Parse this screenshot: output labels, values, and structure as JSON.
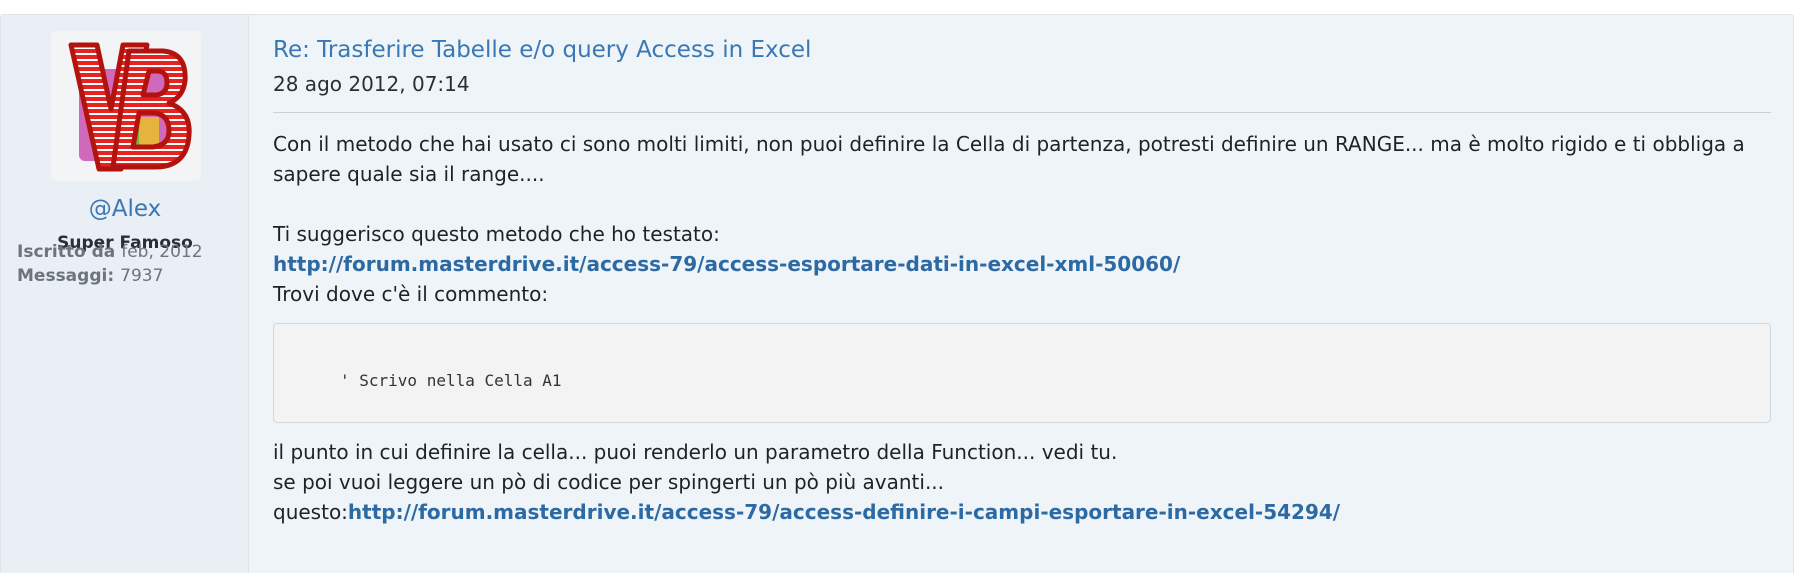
{
  "author": {
    "avatar_icon": "vb-logo-icon",
    "username": "@Alex",
    "rank": "Super Famoso",
    "joined_label": "Iscritto da",
    "joined_value": "feb, 2012",
    "messages_label": "Messaggi:",
    "messages_value": "7937"
  },
  "post": {
    "title": "Re: Trasferire Tabelle e/o query Access in Excel",
    "date": "28 ago 2012, 07:14",
    "paragraph1_line1": "Con il metodo che hai usato ci sono molti limiti, non puoi definire la Cella di partenza, potresti definire un RANGE... ma è molto rigido e ti obbliga a",
    "paragraph1_line2": "sapere quale sia il range....",
    "suggest_text": "Ti suggerisco questo metodo che ho testato:",
    "link1": "http://forum.masterdrive.it/access-79/access-esportare-dati-in-excel-xml-50060/",
    "find_comment_text": "Trovi dove c'è il commento:",
    "code_line": "' Scrivo nella Cella A1",
    "after_code_line1": "il punto in cui definire la cella... puoi renderlo un parametro della Function... vedi tu.",
    "after_code_line2": "se poi vuoi leggere un pò di codice per spingerti un pò più avanti...",
    "link2_prefix": "questo:",
    "link2": "http://forum.masterdrive.it/access-79/access-definire-i-campi-esportare-in-excel-54294/"
  },
  "colors": {
    "link": "#2d6aa4",
    "title": "#3a78b3",
    "post_background": "#eef4f8",
    "author_background": "#e9eff4",
    "avatar_red": "#e52421"
  }
}
